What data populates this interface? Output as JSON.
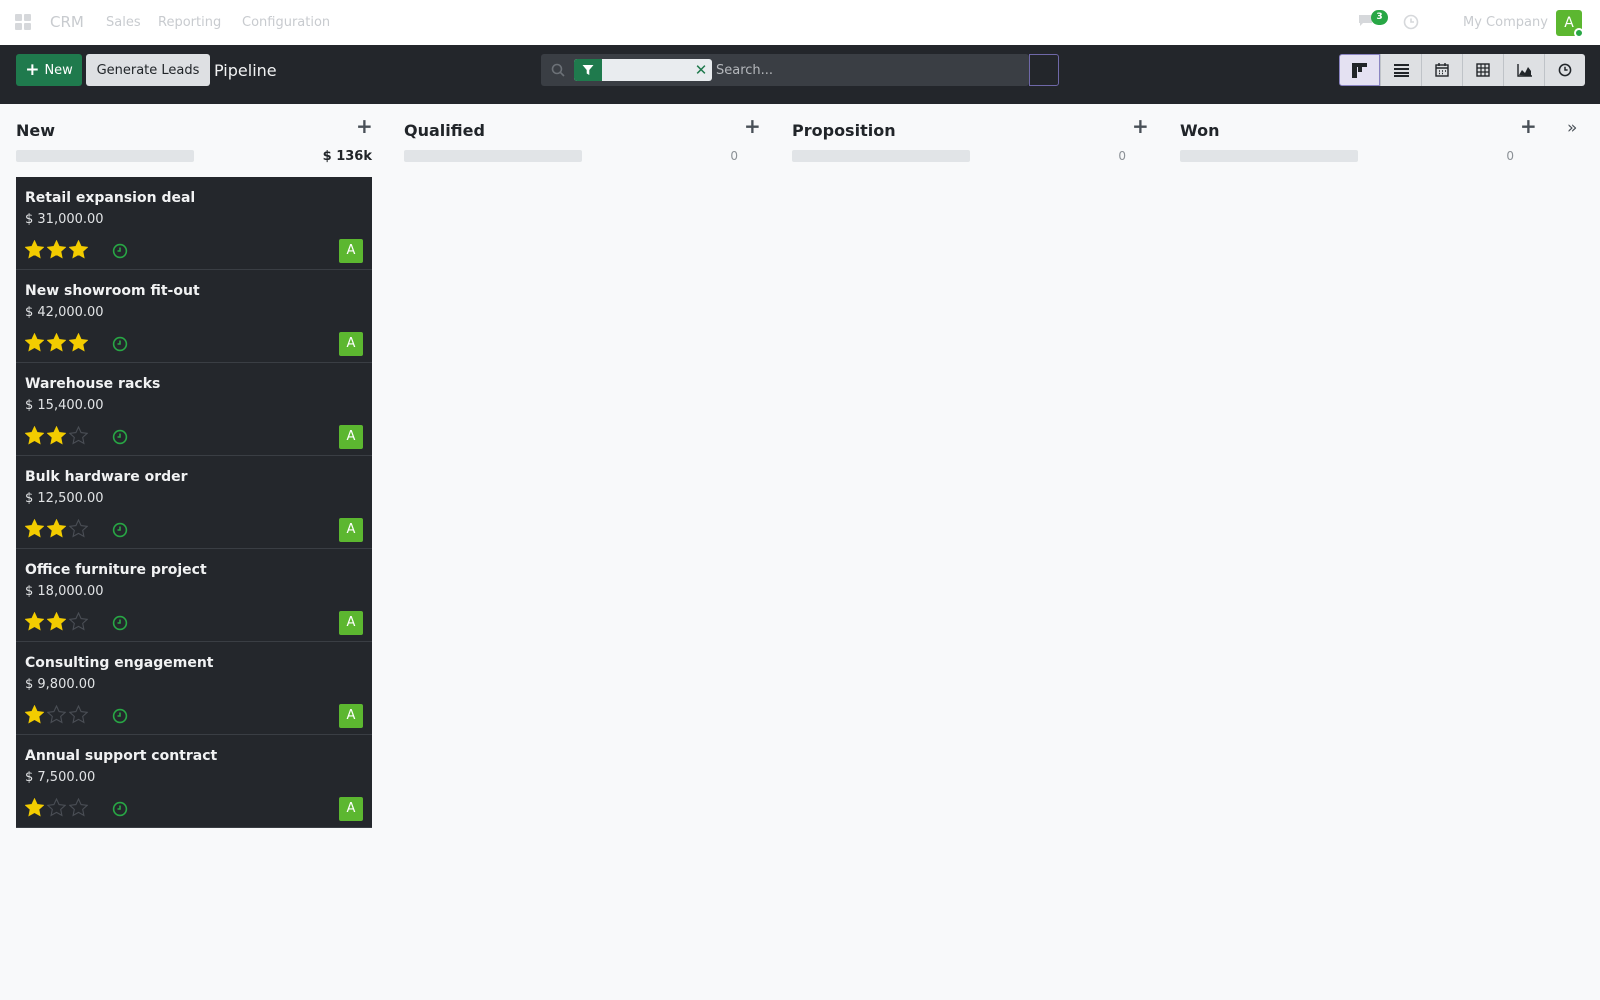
{
  "navbar": {
    "brand": "CRM",
    "menu": [
      {
        "label": "Sales"
      },
      {
        "label": "Reporting"
      },
      {
        "label": "Configuration"
      }
    ],
    "chat_count": "3",
    "company": "My Company",
    "user_initial": "A"
  },
  "controls": {
    "new_label": "New",
    "generate_label": "Generate Leads",
    "breadcrumb": "Pipeline",
    "search_placeholder": "Search...",
    "facet_icon": "filter-icon",
    "view_icons": [
      "kanban-icon",
      "list-icon",
      "calendar-icon",
      "pivot-icon",
      "graph-icon",
      "activity-icon"
    ]
  },
  "colors": {
    "accent": "#1f7a4d",
    "avatar": "#5cb730",
    "star_on": "#f3cc00",
    "star_off": "#4a4e55",
    "activity": "#28a745"
  },
  "stages": [
    {
      "name": "New",
      "total": "$ 136k"
    },
    {
      "name": "Qualified",
      "total": "0"
    },
    {
      "name": "Proposition",
      "total": "0"
    },
    {
      "name": "Won",
      "total": "0"
    }
  ],
  "cards": [
    {
      "title": "Retail expansion deal",
      "amount": "$ 31,000.00",
      "stars": 3,
      "assignee": "A"
    },
    {
      "title": "New showroom fit-out",
      "amount": "$ 42,000.00",
      "stars": 3,
      "assignee": "A"
    },
    {
      "title": "Warehouse racks",
      "amount": "$ 15,400.00",
      "stars": 2,
      "assignee": "A"
    },
    {
      "title": "Bulk hardware order",
      "amount": "$ 12,500.00",
      "stars": 2,
      "assignee": "A"
    },
    {
      "title": "Office furniture project",
      "amount": "$ 18,000.00",
      "stars": 2,
      "assignee": "A"
    },
    {
      "title": "Consulting engagement",
      "amount": "$ 9,800.00",
      "stars": 1,
      "assignee": "A"
    },
    {
      "title": "Annual support contract",
      "amount": "$ 7,500.00",
      "stars": 1,
      "assignee": "A"
    }
  ]
}
